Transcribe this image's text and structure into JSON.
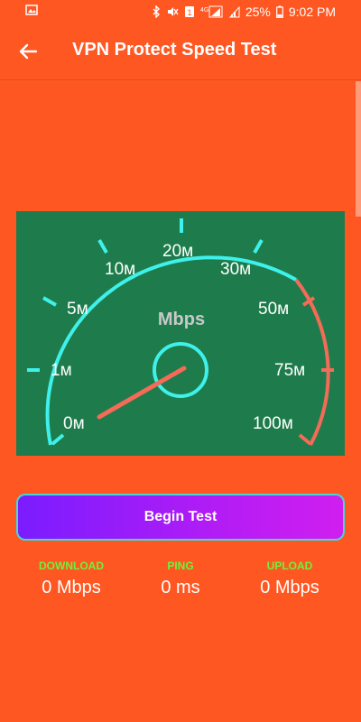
{
  "status_bar": {
    "battery": "25%",
    "time": "9:02 PM"
  },
  "app_bar": {
    "title": "VPN Protect Speed Test"
  },
  "gauge": {
    "unit_label": "Mbps",
    "ticks": [
      "0м",
      "1м",
      "5м",
      "10м",
      "20м",
      "30м",
      "50м",
      "75м",
      "100м"
    ],
    "needle_value": "0",
    "colors": {
      "panel": "#1E7C4C",
      "arc": "#3EF1EA",
      "arc_high": "#F46B58",
      "needle": "#F46B58"
    }
  },
  "action": {
    "begin_label": "Begin Test"
  },
  "stats": {
    "download": {
      "label": "DOWNLOAD",
      "value": "0 Mbps"
    },
    "ping": {
      "label": "PING",
      "value": "0 ms"
    },
    "upload": {
      "label": "UPLOAD",
      "value": "0 Mbps"
    }
  },
  "colors": {
    "background": "#FF5722",
    "stat_label": "#6CF33C",
    "button_border": "#45D8D4"
  }
}
